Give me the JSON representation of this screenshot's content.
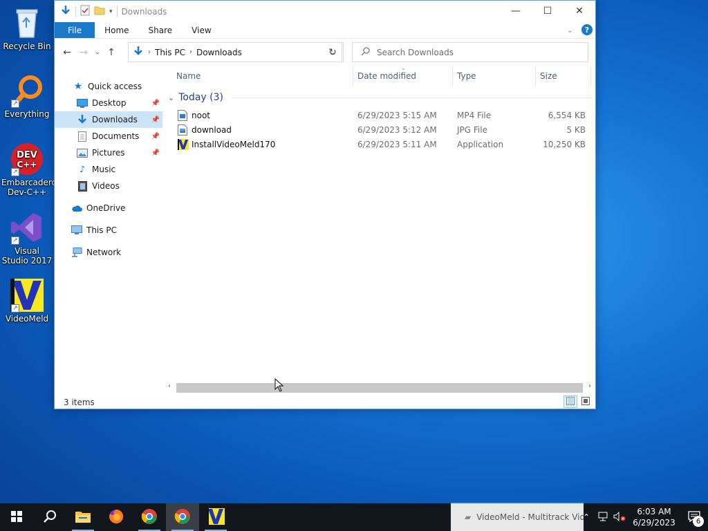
{
  "desktop": {
    "icons": [
      {
        "label": "Recycle Bin"
      },
      {
        "label": "Everything"
      },
      {
        "label": "Embarcadero Dev-C++"
      },
      {
        "label": "Visual Studio 2017"
      },
      {
        "label": "VideoMeld"
      }
    ]
  },
  "window": {
    "title": "Downloads",
    "ribbon_tabs": [
      "File",
      "Home",
      "Share",
      "View"
    ],
    "address": {
      "segments": [
        "This PC",
        "Downloads"
      ]
    },
    "search_placeholder": "Search Downloads",
    "nav": [
      {
        "label": "Quick access",
        "icon": "star-icon"
      },
      {
        "label": "Desktop",
        "icon": "desktop-icon",
        "pinned": true
      },
      {
        "label": "Downloads",
        "icon": "download-icon",
        "pinned": true,
        "selected": true
      },
      {
        "label": "Documents",
        "icon": "documents-icon",
        "pinned": true
      },
      {
        "label": "Pictures",
        "icon": "pictures-icon",
        "pinned": true
      },
      {
        "label": "Music",
        "icon": "music-icon"
      },
      {
        "label": "Videos",
        "icon": "videos-icon"
      },
      {
        "label": "OneDrive",
        "icon": "cloud-icon"
      },
      {
        "label": "This PC",
        "icon": "computer-icon"
      },
      {
        "label": "Network",
        "icon": "network-icon"
      }
    ],
    "columns": [
      "Name",
      "Date modified",
      "Type",
      "Size"
    ],
    "group_label": "Today (3)",
    "files": [
      {
        "name": "noot",
        "date": "6/29/2023 5:15 AM",
        "type": "MP4 File",
        "size": "6,554 KB",
        "icon": "video-file-icon"
      },
      {
        "name": "download",
        "date": "6/29/2023 5:12 AM",
        "type": "JPG File",
        "size": "5 KB",
        "icon": "image-file-icon"
      },
      {
        "name": "InstallVideoMeld170",
        "date": "6/29/2023 5:11 AM",
        "type": "Application",
        "size": "10,250 KB",
        "icon": "videomeld-app-icon"
      }
    ],
    "status": "3 items"
  },
  "taskbar": {
    "preview_text": "VideoMeld - Multitrack Vid",
    "time": "6:03 AM",
    "date": "6/29/2023",
    "notification_count": "6"
  }
}
